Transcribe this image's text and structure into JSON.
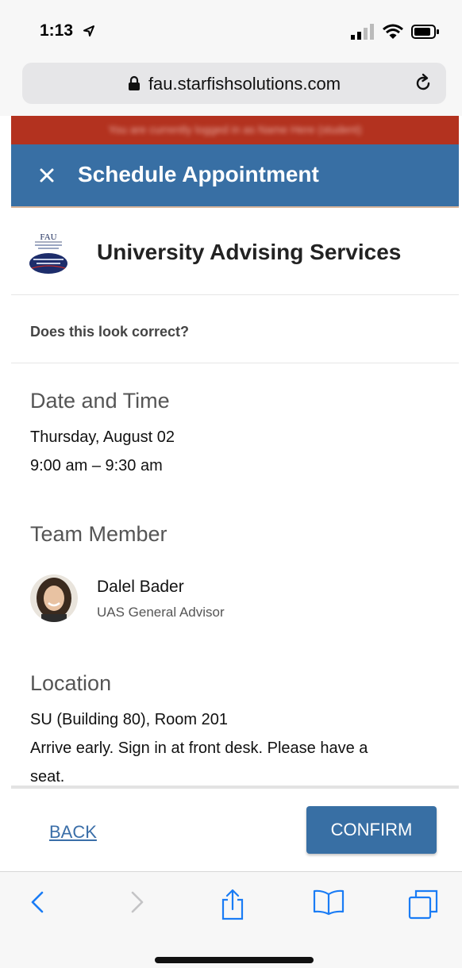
{
  "status_bar": {
    "time": "1:13"
  },
  "browser": {
    "url": "fau.starfishsolutions.com"
  },
  "banner": {
    "text": "You are currently logged in as Name Here (student)"
  },
  "header": {
    "title": "Schedule Appointment"
  },
  "service": {
    "logo_text": "FAU",
    "name": "University Advising Services"
  },
  "confirm_prompt": "Does this look correct?",
  "date_time": {
    "heading": "Date and Time",
    "date": "Thursday, August 02",
    "time": "9:00 am – 9:30 am"
  },
  "team": {
    "heading": "Team Member",
    "name": "Dalel Bader",
    "role": "UAS General Advisor"
  },
  "location": {
    "heading": "Location",
    "place": "SU (Building 80), Room 201",
    "note_line1": "Arrive early. Sign in at front desk. Please have a",
    "note_line2": "seat."
  },
  "footer": {
    "back_label": "BACK",
    "confirm_label": "CONFIRM"
  },
  "colors": {
    "brand_blue": "#386fa4",
    "banner_red": "#b3321f"
  }
}
